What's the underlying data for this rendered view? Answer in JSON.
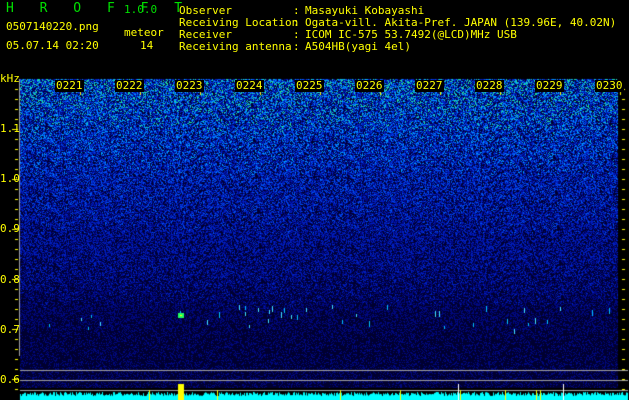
{
  "header": {
    "app_name": "H R O F F T",
    "version": "1.0.0",
    "filename": "0507140220.png",
    "datetime": "05.07.14 02:20",
    "meteor_label": "meteor",
    "meteor_count": "14"
  },
  "info": [
    {
      "label": "Observer",
      "value": "Masayuki Kobayashi"
    },
    {
      "label": "Receiving Location",
      "value": "Ogata-vill. Akita-Pref. JAPAN (139.96E, 40.02N)"
    },
    {
      "label": "Receiver",
      "value": "ICOM IC-575 53.7492(@LCD)MHz USB"
    },
    {
      "label": "Receiving antenna",
      "value": "A504HB(yagi 4el)"
    }
  ],
  "spectrogram": {
    "y_unit": "kHz",
    "y_ticks": [
      "1.1",
      "1.0",
      "0.9",
      "0.8",
      "0.7",
      "0.6"
    ],
    "time_labels": [
      "0221",
      "0222",
      "0223",
      "0224",
      "0225",
      "0226",
      "0227",
      "0228",
      "0229",
      "0230"
    ],
    "colors": {
      "text": "#ffff00",
      "title": "#00e000",
      "noise_low": "#000060",
      "noise_high": "#0060ff",
      "echo": "#00ffa0",
      "level_bar": "#00ffff",
      "meteor_marker": "#ffff00",
      "guide_line": "#a0a0a0"
    }
  }
}
